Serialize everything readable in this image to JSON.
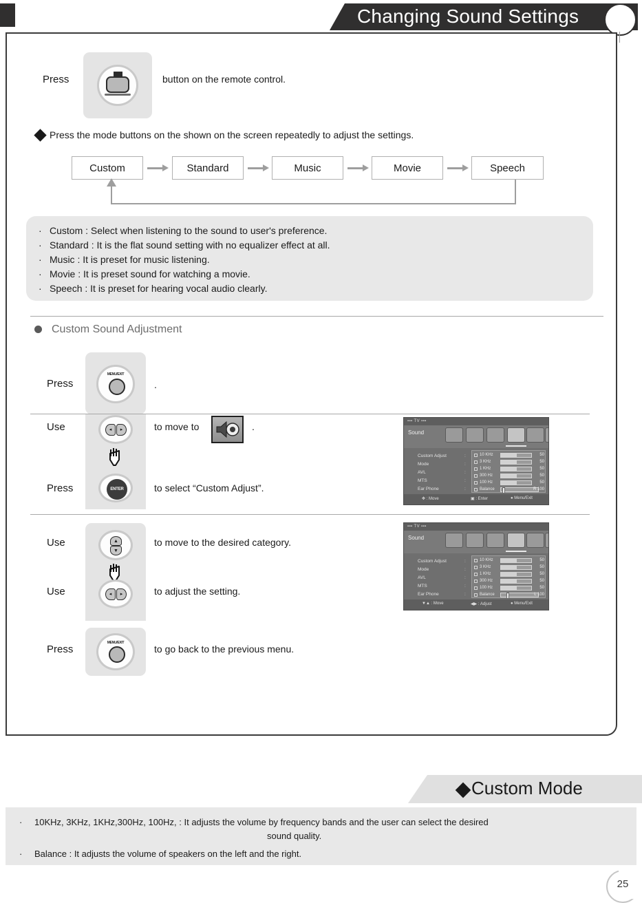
{
  "header": {
    "title": "Changing Sound Settings",
    "circle_icon": "page-marker-circle"
  },
  "intro_step": {
    "press_label": "Press",
    "button_icon": "sound-mode-button-icon",
    "trailing_text": "button on the remote control."
  },
  "mode_note": {
    "text": "Press the mode buttons on the shown on the screen repeatedly to adjust the settings."
  },
  "flow": {
    "modes": [
      "Custom",
      "Standard",
      "Music",
      "Movie",
      "Speech"
    ],
    "loop_back_to": "Custom"
  },
  "descriptions": [
    "Custom : Select when listening to the sound to user's preference.",
    "Standard : It is the flat sound setting with no equalizer effect at all.",
    "Music : It is preset for music listening.",
    "Movie : It is preset sound for watching a movie.",
    "Speech : It is preset for hearing vocal audio clearly."
  ],
  "section": {
    "heading": "Custom Sound Adjustment"
  },
  "steps": [
    {
      "verb": "Press",
      "button_icon": "menu-button-icon",
      "button_cap": "MENU/EXIT",
      "text": "."
    },
    {
      "verb": "Use",
      "button_icon": "left-right-arrow-button-icon",
      "text": "to move to",
      "inline_icon": "speaker-menu-icon",
      "text_after": "."
    },
    {
      "verb": "Press",
      "button_icon": "enter-button-icon",
      "button_cap": "ENTER",
      "text": "to select “Custom Adjust”."
    },
    {
      "verb": "Use",
      "button_icon": "up-down-arrow-button-icon",
      "text": "to  move to the desired category."
    },
    {
      "verb": "Use",
      "button_icon": "left-right-arrow-button-icon",
      "text": "to adjust the setting."
    },
    {
      "verb": "Press",
      "button_icon": "menu-button-icon",
      "button_cap": "MENU/EXIT",
      "text": "to go back to the previous menu."
    }
  ],
  "osd_screens": [
    {
      "name": "sound-menu-custom-adjust-select",
      "top_label": "▪▪▪ TV ▪▪▪",
      "menu_title": "Sound",
      "left_items": [
        "Custom Adjust",
        "Mode",
        "AVL",
        "MTS",
        "Ear Phone"
      ],
      "rows": [
        {
          "label": "10 KHz",
          "value": "50",
          "fill": 52
        },
        {
          "label": "3 KHz",
          "value": "50",
          "fill": 52
        },
        {
          "label": "1 KHz",
          "value": "50",
          "fill": 52
        },
        {
          "label": "300 Hz",
          "value": "50",
          "fill": 52
        },
        {
          "label": "100 Hz",
          "value": "50",
          "fill": 52
        },
        {
          "label": "Balance",
          "value": "R 100",
          "fill": 0,
          "knob": 6
        }
      ],
      "footer": [
        "✥ : Move",
        "▣ : Enter",
        "● Menu/Exit"
      ]
    },
    {
      "name": "sound-menu-custom-adjust-editing",
      "top_label": "▪▪▪ TV ▪▪▪",
      "menu_title": "Sound",
      "left_items": [
        "Custom Adjust",
        "Mode",
        "AVL",
        "MTS",
        "Ear Phone"
      ],
      "rows": [
        {
          "label": "10 KHz",
          "value": "50",
          "fill": 52
        },
        {
          "label": "3 KHz",
          "value": "50",
          "fill": 52
        },
        {
          "label": "1 KHz",
          "value": "50",
          "fill": 52
        },
        {
          "label": "300 Hz",
          "value": "50",
          "fill": 52
        },
        {
          "label": "100 Hz",
          "value": "50",
          "fill": 52
        },
        {
          "label": "Balance",
          "value": "L 100",
          "fill": 0,
          "knob": 12
        }
      ],
      "footer": [
        "▼▲ : Move",
        "◀▶ : Adjust",
        "● Menu/Exit"
      ]
    }
  ],
  "custom_mode": {
    "title": "Custom Mode",
    "lines": [
      "10KHz, 3KHz, 1KHz,300Hz, 100Hz, : It adjusts the volume by frequency bands and the user can select the desired",
      "sound quality.",
      "Balance : It adjusts the volume of speakers on the left and the right."
    ]
  },
  "page": {
    "number": "25"
  },
  "colors": {
    "header_bg": "#302f2f",
    "panel_gray": "#e8e8e8",
    "chip_gray": "#e4e4e4",
    "osd_bg": "#6f6f6f"
  }
}
